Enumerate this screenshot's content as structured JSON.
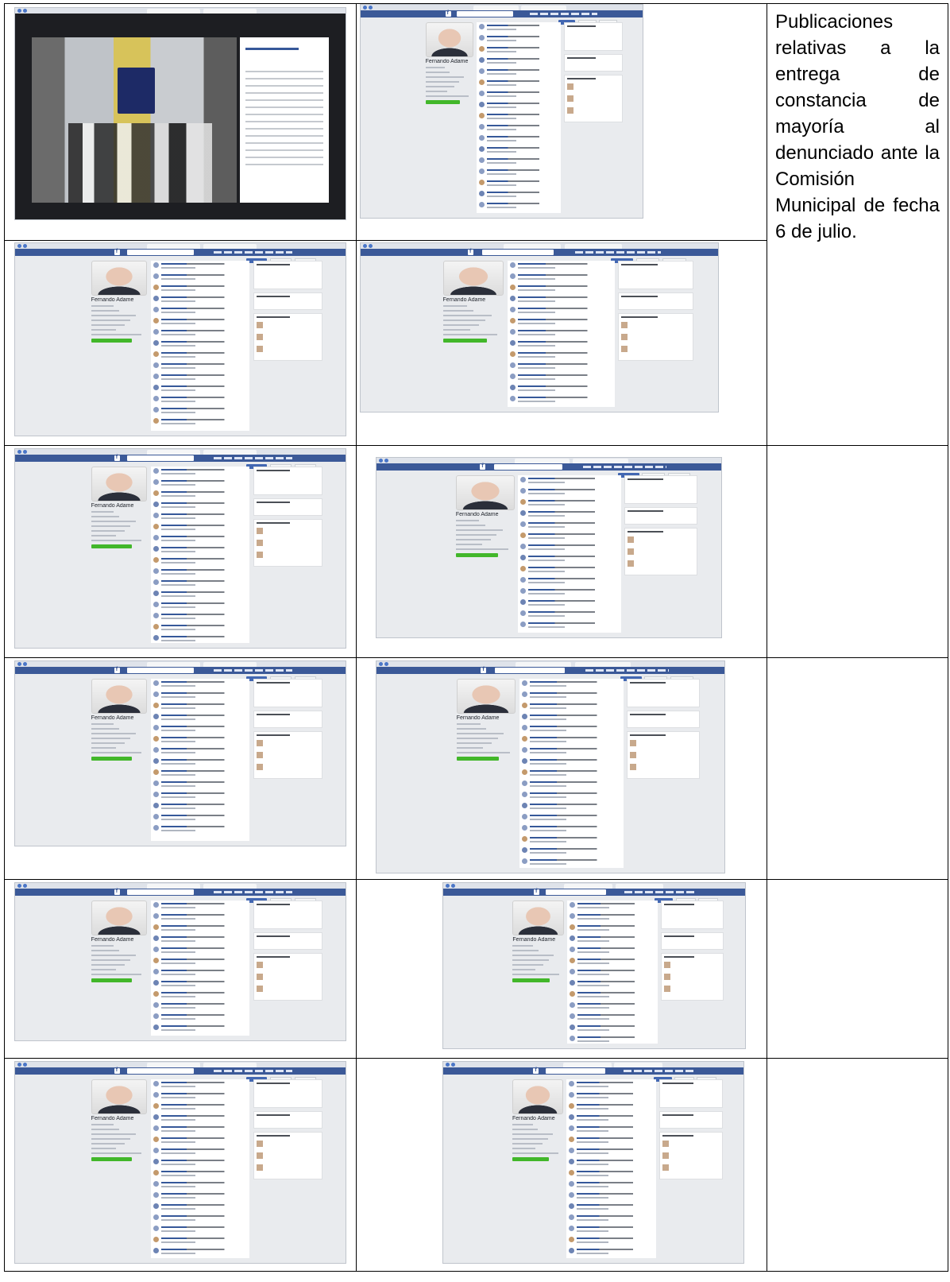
{
  "caption": "Publicaciones relativas a la entrega de constancia de mayoría al denunciado ante la Comisión Municipal de fecha 6 de julio.",
  "profile_name": "Fernando Adame",
  "screenshots": [
    {
      "name": "Fernando Adame",
      "variant": "photo"
    },
    {
      "name": "Fernando Adame",
      "variant": "page"
    },
    {
      "name": "Fernando Adame",
      "variant": "page"
    },
    {
      "name": "Fernando Adame",
      "variant": "page"
    },
    {
      "name": "Fernando Adame",
      "variant": "page"
    },
    {
      "name": "Fernando Adame",
      "variant": "page"
    },
    {
      "name": "Fernando Adame",
      "variant": "page"
    },
    {
      "name": "Fernando Adame",
      "variant": "page"
    },
    {
      "name": "Fernando Adame",
      "variant": "page"
    },
    {
      "name": "Fernando Adame",
      "variant": "page"
    },
    {
      "name": "Fernando Adame",
      "variant": "page"
    },
    {
      "name": "Fernando Adame",
      "variant": "page"
    },
    {
      "name": "Fernando Adame",
      "variant": "page"
    }
  ],
  "colors": {
    "facebook_blue": "#3b5998",
    "create_button_green": "#42b72a",
    "background": "#e9ebee"
  }
}
